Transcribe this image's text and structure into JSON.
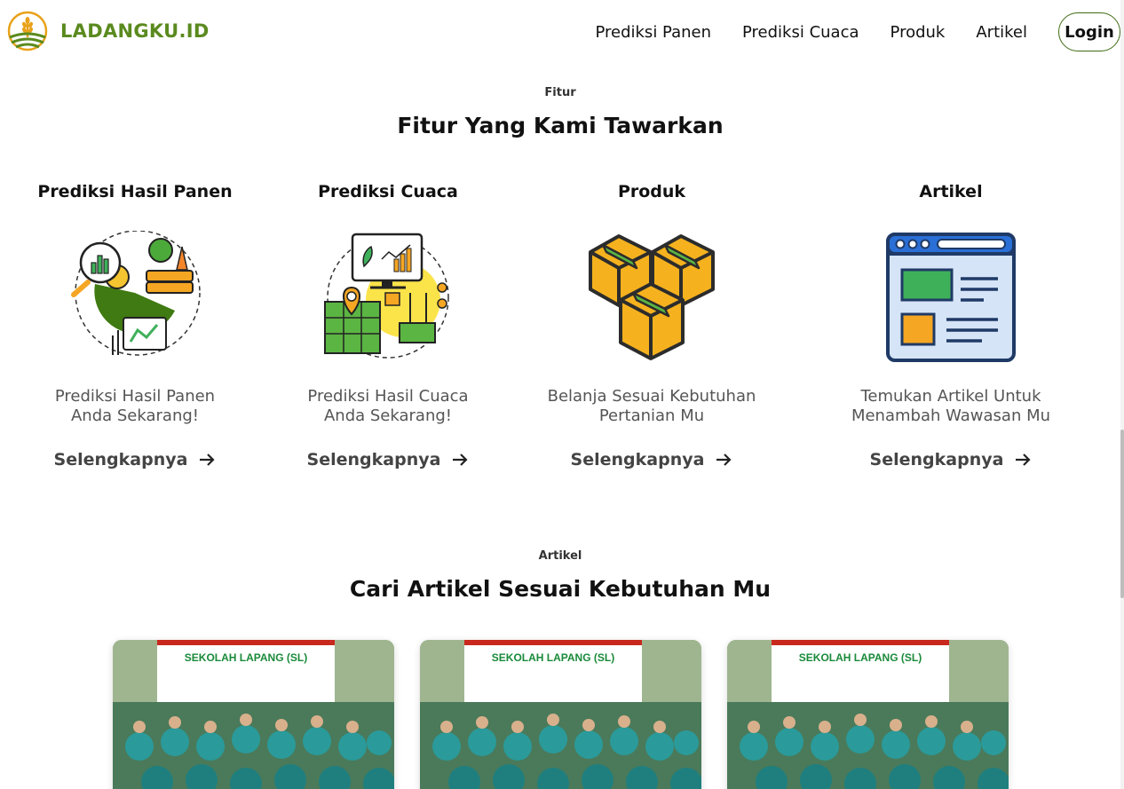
{
  "brand": {
    "name": "LADANGKU.ID",
    "color": "#5a8a1e"
  },
  "nav": {
    "items": [
      {
        "label": "Prediksi Panen"
      },
      {
        "label": "Prediksi Cuaca"
      },
      {
        "label": "Produk"
      },
      {
        "label": "Artikel"
      }
    ],
    "login_label": "Login"
  },
  "features_section": {
    "eyebrow": "Fitur",
    "title": "Fitur Yang Kami Tawarkan",
    "cards": [
      {
        "title": "Prediksi Hasil Panen",
        "description": "Prediksi Hasil Panen\nAnda Sekarang!",
        "link_label": "Selengkapnya",
        "icon": "harvest-prediction-icon"
      },
      {
        "title": "Prediksi Cuaca",
        "description": "Prediksi Hasil Cuaca\nAnda Sekarang!",
        "link_label": "Selengkapnya",
        "icon": "weather-prediction-icon"
      },
      {
        "title": "Produk",
        "description": "Belanja Sesuai Kebutuhan\nPertanian Mu",
        "link_label": "Selengkapnya",
        "icon": "boxes-icon"
      },
      {
        "title": "Artikel",
        "description": "Temukan Artikel Untuk\nMenambah Wawasan Mu",
        "link_label": "Selengkapnya",
        "icon": "article-window-icon"
      }
    ]
  },
  "articles_section": {
    "eyebrow": "Artikel",
    "title": "Cari Artikel Sesuai Kebutuhan Mu",
    "cards": [
      {
        "banner_title": "SEKOLAH LAPANG (SL)"
      },
      {
        "banner_title": "SEKOLAH LAPANG (SL)"
      },
      {
        "banner_title": "SEKOLAH LAPANG (SL)"
      }
    ]
  }
}
